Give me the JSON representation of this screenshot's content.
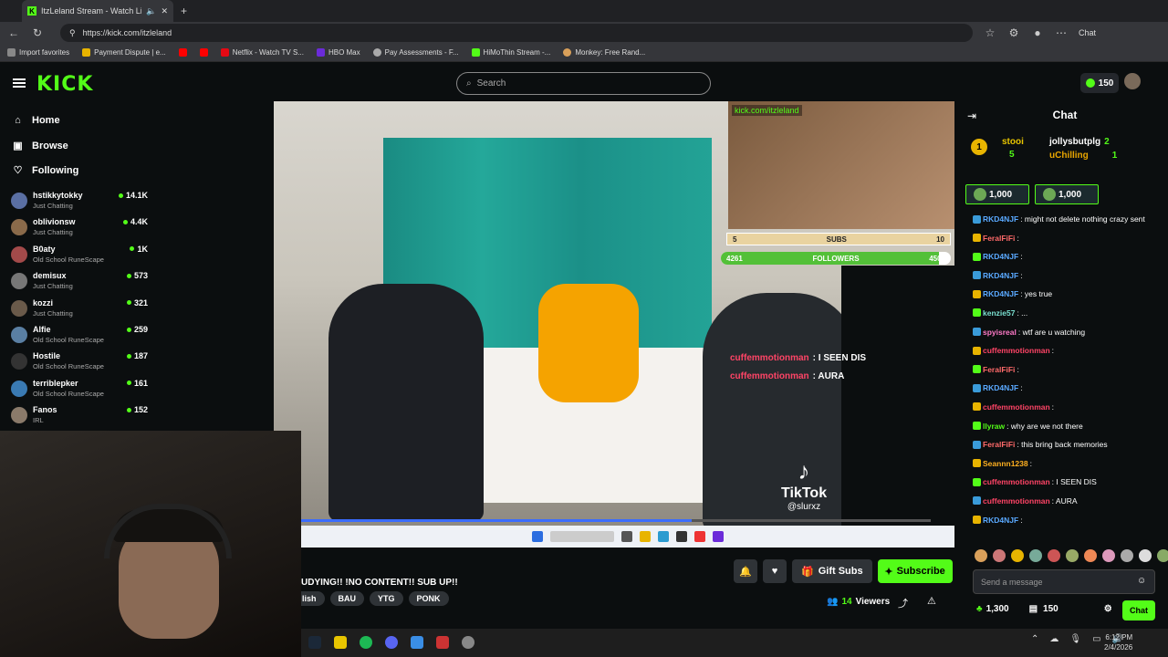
{
  "browser": {
    "tab_title": "ItzLeland Stream - Watch Li",
    "url": "https://kick.com/itzleland",
    "bookmarks": [
      "Import favorites",
      "Payment Dispute | e...",
      "Netflix - Watch TV S...",
      "HBO Max",
      "Pay Assessments - F...",
      "HiMoThin Stream -...",
      "Monkey: Free Rand..."
    ],
    "copilot_label": "Chat"
  },
  "header": {
    "logo": "KICK",
    "search_placeholder": "Search",
    "coins": "150"
  },
  "sidebar": {
    "nav": [
      {
        "label": "Home",
        "icon": "home-icon"
      },
      {
        "label": "Browse",
        "icon": "browse-icon"
      },
      {
        "label": "Following",
        "icon": "heart-icon"
      }
    ],
    "channels": [
      {
        "name": "hstikkytokky",
        "category": "Just Chatting",
        "viewers": "14.1K",
        "color": "#5a6fa3"
      },
      {
        "name": "oblivionsw",
        "category": "Just Chatting",
        "viewers": "4.4K",
        "color": "#8a6a4a"
      },
      {
        "name": "B0aty",
        "category": "Old School RuneScape",
        "viewers": "1K",
        "color": "#a34a4a"
      },
      {
        "name": "demisux",
        "category": "Just Chatting",
        "viewers": "573",
        "color": "#777"
      },
      {
        "name": "kozzi",
        "category": "Just Chatting",
        "viewers": "321",
        "color": "#6a5a4a"
      },
      {
        "name": "Alfie",
        "category": "Old School RuneScape",
        "viewers": "259",
        "color": "#5a7fa3"
      },
      {
        "name": "Hostile",
        "category": "Old School RuneScape",
        "viewers": "187",
        "color": "#333"
      },
      {
        "name": "terriblepker",
        "category": "Old School RuneScape",
        "viewers": "161",
        "color": "#3a7ab3"
      },
      {
        "name": "Fanos",
        "category": "IRL",
        "viewers": "152",
        "color": "#8a7a6a"
      }
    ]
  },
  "video": {
    "cam_url": "kick.com/itzleland",
    "subs_goal": {
      "current": "5",
      "label": "SUBS",
      "target": "10"
    },
    "followers_goal": {
      "current": "4261",
      "label": "FOLLOWERS",
      "target": "4500",
      "progress": 0.947
    },
    "overlay_chat": [
      {
        "user": "cuffemmotionman",
        "text": ": I SEEN DIS"
      },
      {
        "user": "cuffemmotionman",
        "text": ": AURA"
      }
    ],
    "tiktok_label": "TikTok",
    "tiktok_handle": "@slurxz",
    "playback_progress": 0.62
  },
  "stream": {
    "title": "UDYING!! !NO CONTENT!! SUB UP!!",
    "tags": [
      "lish",
      "BAU",
      "YTG",
      "PONK"
    ],
    "gift_label": "Gift Subs",
    "subscribe_label": "Subscribe",
    "viewers_count": "14",
    "viewers_label": "Viewers"
  },
  "taskbar": {
    "time": "6:12 PM",
    "date": "2/4/2026"
  },
  "chat": {
    "title": "Chat",
    "leaderboard": [
      {
        "rank": "1",
        "name": "stooi",
        "count": "5"
      },
      {
        "name": "jollysbutplg",
        "count": "2"
      },
      {
        "name": "uChilling",
        "count": "1"
      }
    ],
    "gift_cards": [
      "1,000",
      "1,000"
    ],
    "messages": [
      {
        "user": "RKD4NJF",
        "color": "#5aa9ff",
        "text": ": might not delete nothing crazy sent"
      },
      {
        "user": "FeralFiFi",
        "color": "#ff6a6a",
        "text": ":"
      },
      {
        "user": "RKD4NJF",
        "color": "#5aa9ff",
        "text": ":"
      },
      {
        "user": "RKD4NJF",
        "color": "#5aa9ff",
        "text": ":"
      },
      {
        "user": "RKD4NJF",
        "color": "#5aa9ff",
        "text": ": yes true"
      },
      {
        "user": "kenzie57",
        "color": "#7ae0d0",
        "text": ": ..."
      },
      {
        "user": "spyisreal",
        "color": "#ff7ac8",
        "text": ": wtf are u watching"
      },
      {
        "user": "cuffemmotionman",
        "color": "#ff4466",
        "text": ":"
      },
      {
        "user": "FeralFiFi",
        "color": "#ff6a6a",
        "text": ":"
      },
      {
        "user": "RKD4NJF",
        "color": "#5aa9ff",
        "text": ":"
      },
      {
        "user": "cuffemmotionman",
        "color": "#ff4466",
        "text": ":"
      },
      {
        "user": "llyraw",
        "color": "#53fc18",
        "text": ": why are we not there"
      },
      {
        "user": "FeralFiFi",
        "color": "#ff6a6a",
        "text": ": this bring back memories"
      },
      {
        "user": "Seannn1238",
        "color": "#ffb020",
        "text": ":"
      },
      {
        "user": "cuffemmotionman",
        "color": "#ff4466",
        "text": ": I SEEN DIS"
      },
      {
        "user": "cuffemmotionman",
        "color": "#ff4466",
        "text": ": AURA"
      },
      {
        "user": "RKD4NJF",
        "color": "#5aa9ff",
        "text": ":"
      }
    ],
    "input_placeholder": "Send a message",
    "points": "1,300",
    "sub_count": "150",
    "chat_button": "Chat"
  }
}
